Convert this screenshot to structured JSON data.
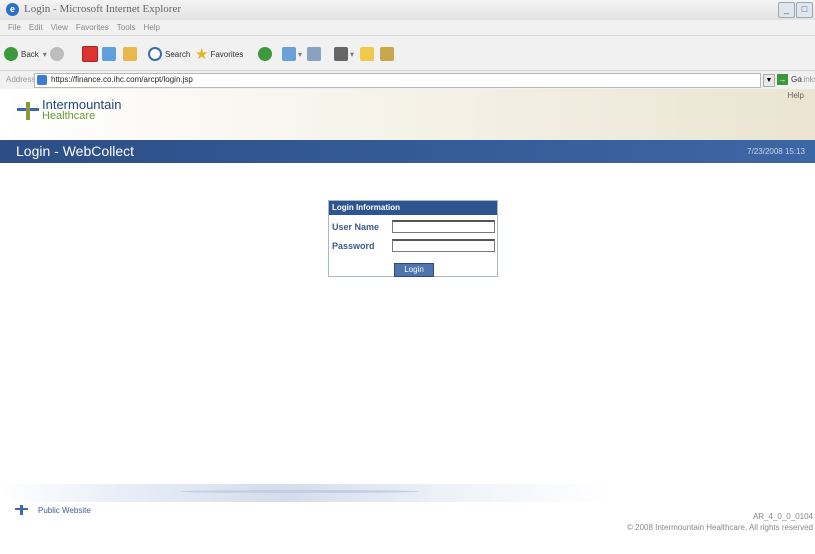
{
  "window": {
    "title": "Login - Microsoft Internet Explorer",
    "controls": [
      "_",
      "□"
    ]
  },
  "menu": [
    "File",
    "Edit",
    "View",
    "Favorites",
    "Tools",
    "Help"
  ],
  "toolbar": {
    "back_label": "Back",
    "search_label": "Search",
    "favorites_label": "Favorites"
  },
  "address": {
    "label": "Address",
    "url": "https://finance.co.ihc.com/arcpt/login.jsp",
    "go_label": "Go",
    "links_label": "Links"
  },
  "header": {
    "logo_line1": "Intermountain",
    "logo_line2": "Healthcare",
    "help_link": "Help"
  },
  "banner": {
    "page_title": "Login - WebCollect",
    "datetime": "7/23/2008 15:13"
  },
  "login": {
    "section_title": "Login Information",
    "username_label": "User Name",
    "username_value": "",
    "password_label": "Password",
    "password_value": "",
    "submit_label": "Login"
  },
  "footer": {
    "public_website_link": "Public Website",
    "version": "AR_4_0_0_0104",
    "copyright": "© 2008 Intermountain Healthcare, All rights reserved"
  },
  "colors": {
    "banner": "#3d67a4",
    "login_header": "#2e5590",
    "label_text": "#3d5c8c"
  }
}
